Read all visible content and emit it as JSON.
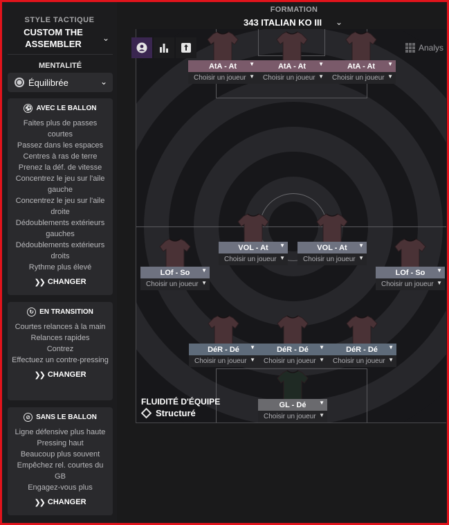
{
  "sidebar": {
    "style_title": "STYLE TACTIQUE",
    "style_name": "CUSTOM THE ASSEMBLER",
    "mentality_title": "MENTALITÉ",
    "mentality_value": "Équilibrée",
    "cards": [
      {
        "title": "AVEC LE BALLON",
        "icon": "ball-icon",
        "items": [
          "Faites plus de passes courtes",
          "Passez dans les espaces",
          "Centres à ras de terre",
          "Prenez la déf. de vitesse",
          "Concentrez le jeu sur l'aile gauche",
          "Concentrez le jeu sur l'aile droite",
          "Dédoublements extérieurs gauches",
          "Dédoublements extérieurs droits",
          "Rythme plus élevé"
        ],
        "change": "CHANGER"
      },
      {
        "title": "EN TRANSITION",
        "icon": "transition-icon",
        "items": [
          "Courtes relances à la main",
          "Relances rapides",
          "Contrez",
          "Effectuez un contre-pressing"
        ],
        "change": "CHANGER"
      },
      {
        "title": "SANS LE BALLON",
        "icon": "no-ball-icon",
        "items": [
          "Ligne défensive plus haute",
          "Pressing haut",
          "Beaucoup plus souvent",
          "Empêchez rel. courtes du GB",
          "Engagez-vous plus"
        ],
        "change": "CHANGER"
      }
    ]
  },
  "formation": {
    "title": "FORMATION",
    "name": "343 ITALIAN KO  III"
  },
  "toolbar": {
    "analyse_label": "Analys"
  },
  "pick_label": "Choisir un joueur",
  "players": [
    {
      "role": "AtA - At",
      "line": "att"
    },
    {
      "role": "AtA - At",
      "line": "att"
    },
    {
      "role": "AtA - At",
      "line": "att"
    },
    {
      "role": "VOL - At",
      "line": "mid"
    },
    {
      "role": "VOL - At",
      "line": "mid"
    },
    {
      "role": "LOf - So",
      "line": "mid"
    },
    {
      "role": "LOf - So",
      "line": "mid"
    },
    {
      "role": "DéR - Dé",
      "line": "def"
    },
    {
      "role": "DéR - Dé",
      "line": "def"
    },
    {
      "role": "DéR - Dé",
      "line": "def"
    },
    {
      "role": "GL - Dé",
      "line": "gk"
    }
  ],
  "fluidity": {
    "title": "FLUIDITÉ D'ÉQUIPE",
    "value": "Structuré"
  },
  "colors": {
    "frame": "#e1141c",
    "attack_role": "#7a5a6a",
    "midfield_role": "#6e7280",
    "defence_role": "#5e6b7a",
    "outfield_shirt": "#4a3236",
    "goalkeeper_shirt": "#1f2a24"
  }
}
